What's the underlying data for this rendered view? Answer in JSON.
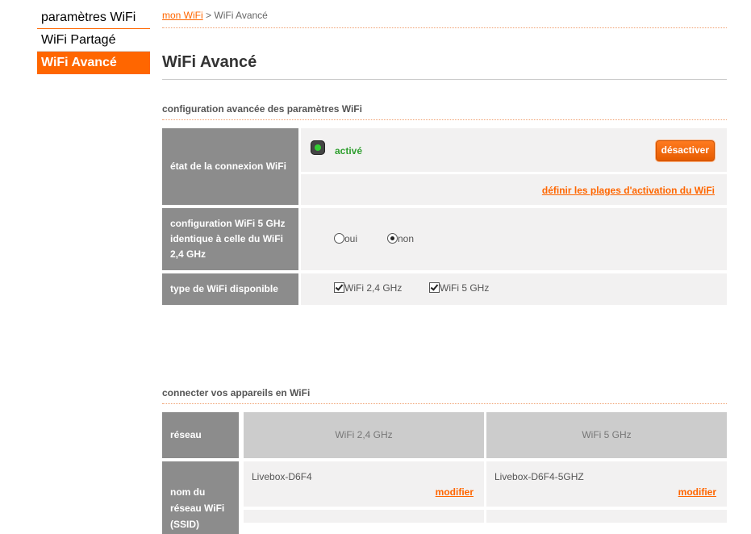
{
  "sidebar": {
    "items": [
      {
        "label": "paramètres WiFi"
      },
      {
        "label": "WiFi Partagé"
      },
      {
        "label": "WiFi Avancé"
      }
    ]
  },
  "breadcrumb": {
    "link": "mon WiFi",
    "separator": ">",
    "current": "WiFi Avancé"
  },
  "page": {
    "title": "WiFi Avancé"
  },
  "config_section": {
    "title": "configuration avancée des paramètres WiFi",
    "connection_state": {
      "label": "état de la connexion WiFi",
      "status": "activé",
      "button": "désactiver",
      "schedule_link": "définir les plages d'activation du WiFi"
    },
    "identical_config": {
      "label": "configuration WiFi 5 GHz identique à celle du WiFi 2,4 GHz",
      "option_yes": "oui",
      "option_no": "non",
      "selected": "non"
    },
    "wifi_type": {
      "label": "type de WiFi disponible",
      "option_24": "WiFi 2,4 GHz",
      "option_5": "WiFi 5 GHz"
    }
  },
  "connect_section": {
    "title": "connecter vos appareils en WiFi",
    "network_label": "réseau",
    "band_24": "WiFi 2,4 GHz",
    "band_5": "WiFi 5 GHz",
    "ssid_label": "nom du réseau WiFi (SSID)",
    "ssid_24": "Livebox-D6F4",
    "ssid_5": "Livebox-D6F4-5GHZ",
    "modify": "modifier"
  },
  "colors": {
    "accent": "#ff6600",
    "label_bg": "#8c8c8c",
    "value_bg": "#f2f1f1",
    "active_green": "#2e9e2e"
  }
}
